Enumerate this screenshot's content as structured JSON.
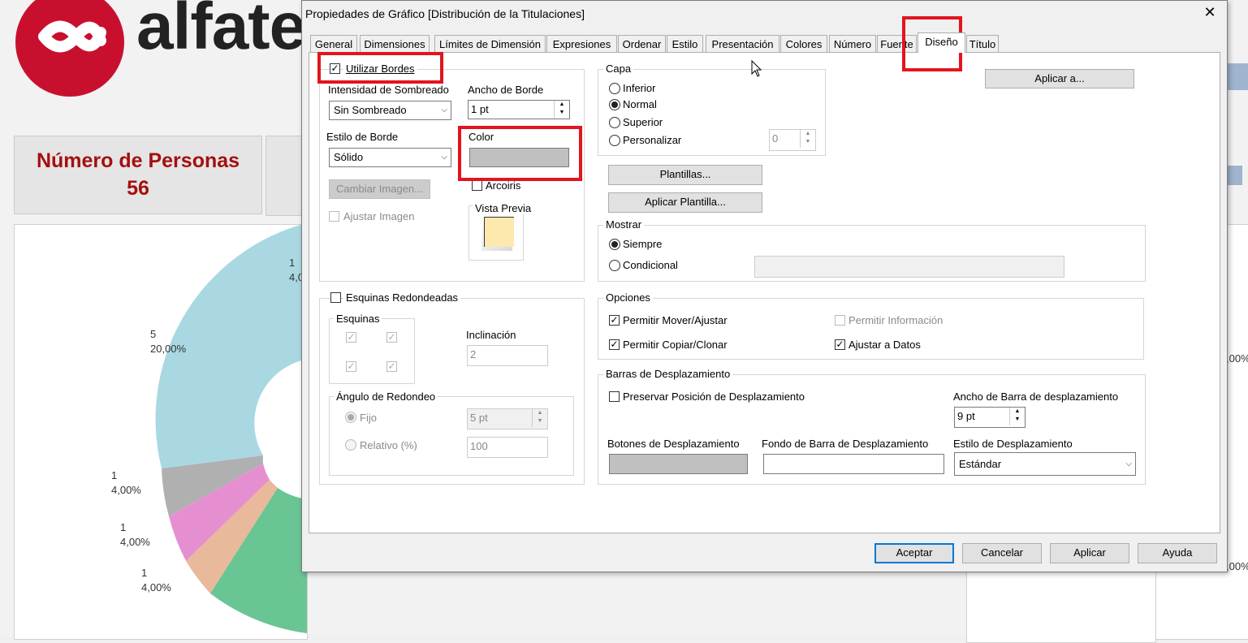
{
  "background": {
    "logo_text": "alfate",
    "kpi": {
      "label": "Número de Personas",
      "value": "56"
    },
    "pie_labels": [
      {
        "count": "1",
        "pct": "4,0"
      },
      {
        "count": "5",
        "pct": "20,00%"
      },
      {
        "count": "1",
        "pct": "4,00%"
      },
      {
        "count": "1",
        "pct": "4,00%"
      },
      {
        "count": "1",
        "pct": "4,00%"
      }
    ],
    "right_pct": ",00%",
    "right_pct2": ",00%",
    "colors": {
      "brand": "#c8102e",
      "kpi_text": "#a50f0f"
    }
  },
  "dialog": {
    "title": "Propiedades de Gráfico [Distribución de la Titulaciones]",
    "close": "✕",
    "tabs": [
      "General",
      "Dimensiones",
      "Límites de Dimensión",
      "Expresiones",
      "Ordenar",
      "Estilo",
      "Presentación",
      "Colores",
      "Número",
      "Fuente",
      "Diseño",
      "Título"
    ],
    "active_tab": "Diseño",
    "borders": {
      "use_borders_label": "Utilizar Bordes",
      "use_borders_checked": true,
      "shade_label": "Intensidad de Sombreado",
      "shade_value": "Sin Sombreado",
      "border_width_label": "Ancho de Borde",
      "border_width_value": "1 pt",
      "border_style_label": "Estilo de Borde",
      "border_style_value": "Sólido",
      "color_label": "Color",
      "rainbow_label": "Arcoiris",
      "change_image_label": "Cambiar Imagen...",
      "adjust_image_label": "Ajustar Imagen",
      "preview_label": "Vista Previa"
    },
    "corners": {
      "rounded_label": "Esquinas Redondeadas",
      "corners_label": "Esquinas",
      "slope_label": "Inclinación",
      "slope_value": "2",
      "angle_label": "Ángulo de Redondeo",
      "fixed_label": "Fijo",
      "fixed_value": "5 pt",
      "relative_label": "Relativo (%)",
      "relative_value": "100"
    },
    "layer": {
      "label": "Capa",
      "options": [
        "Inferior",
        "Normal",
        "Superior",
        "Personalizar"
      ],
      "selected": "Normal",
      "custom_value": "0"
    },
    "apply_to_label": "Aplicar a...",
    "templates_label": "Plantillas...",
    "apply_template_label": "Aplicar Plantilla...",
    "show": {
      "label": "Mostrar",
      "always_label": "Siempre",
      "conditional_label": "Condicional"
    },
    "options": {
      "label": "Opciones",
      "move_resize": "Permitir Mover/Ajustar",
      "copy_clone": "Permitir Copiar/Clonar",
      "info": "Permitir Información",
      "fit_data": "Ajustar a Datos"
    },
    "scroll": {
      "label": "Barras de Desplazamiento",
      "preserve_label": "Preservar Posición de Desplazamiento",
      "width_label": "Ancho de Barra de desplazamiento",
      "width_value": "9 pt",
      "buttons_label": "Botones de Desplazamiento",
      "background_label": "Fondo de Barra de Desplazamiento",
      "style_label": "Estilo de Desplazamiento",
      "style_value": "Estándar"
    },
    "footer": {
      "ok": "Aceptar",
      "cancel": "Cancelar",
      "apply": "Aplicar",
      "help": "Ayuda"
    },
    "colors": {
      "highlight": "#e3141e",
      "swatch": "#c0c0c0",
      "focus": "#0078d7"
    }
  }
}
